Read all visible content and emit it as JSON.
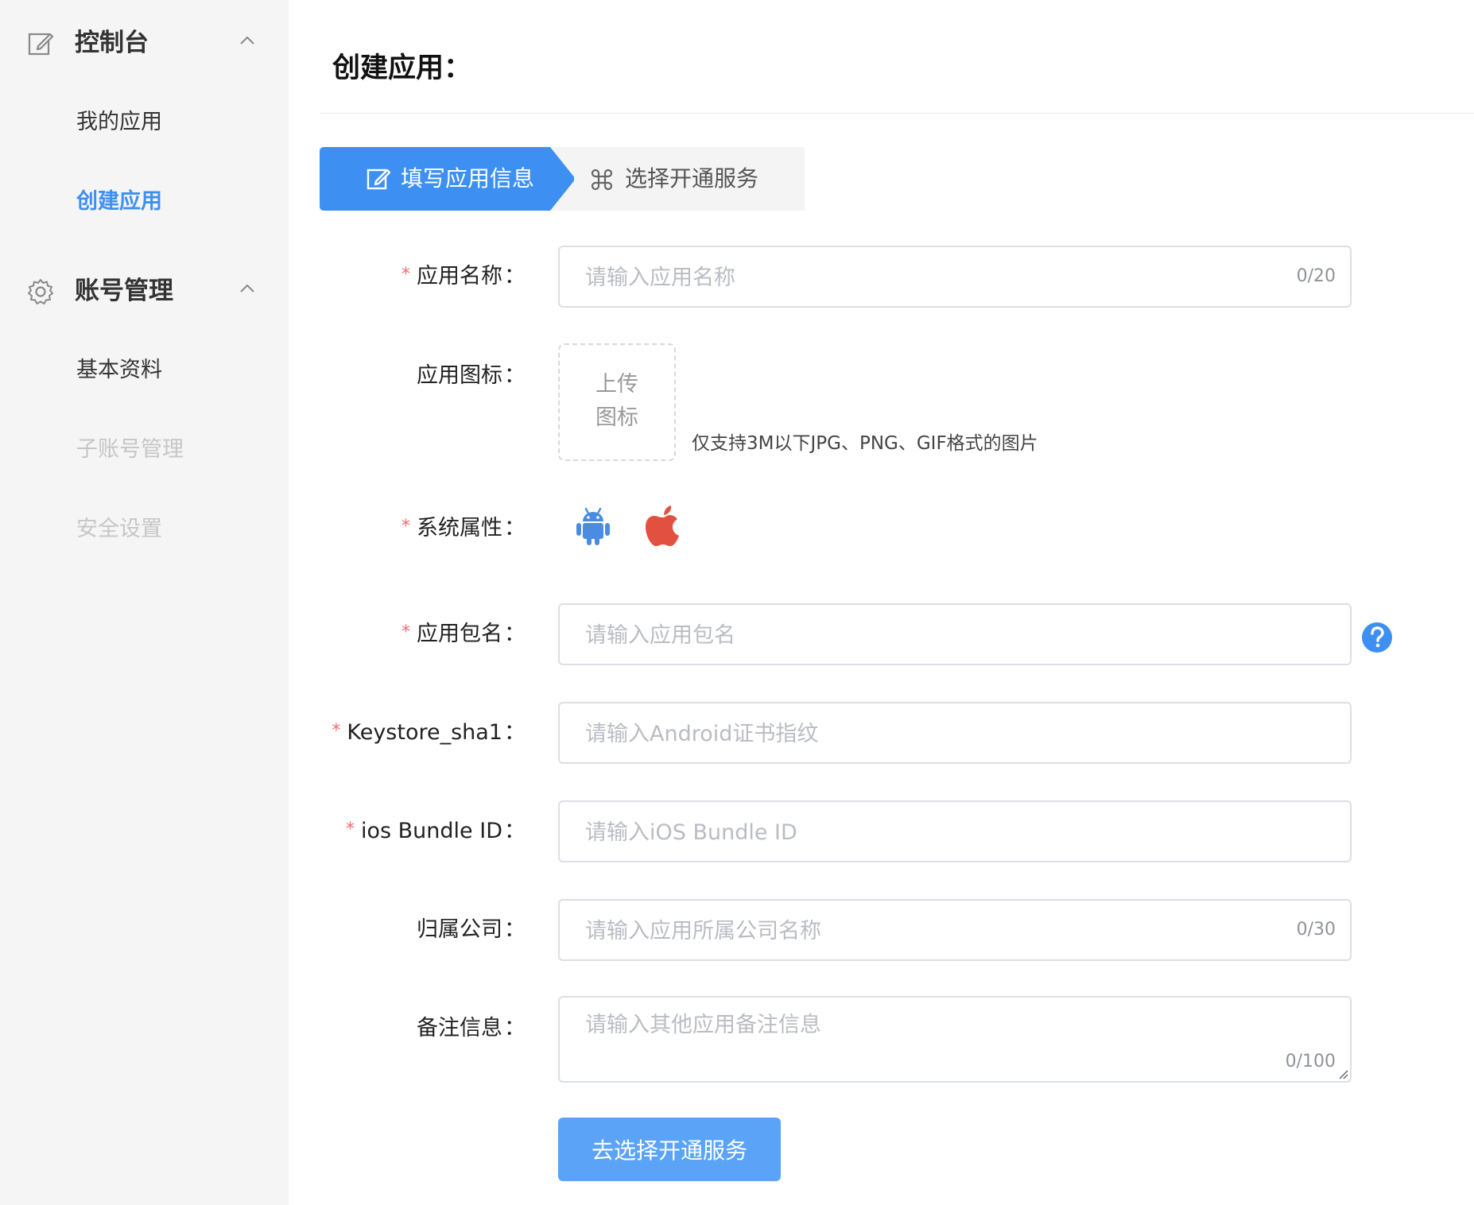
{
  "sidebar": {
    "groups": [
      {
        "title": "控制台",
        "icon": "edit-icon",
        "items": [
          {
            "label": "我的应用",
            "state": "normal"
          },
          {
            "label": "创建应用",
            "state": "active"
          }
        ]
      },
      {
        "title": "账号管理",
        "icon": "gear-icon",
        "items": [
          {
            "label": "基本资料",
            "state": "normal"
          },
          {
            "label": "子账号管理",
            "state": "disabled"
          },
          {
            "label": "安全设置",
            "state": "disabled"
          }
        ]
      }
    ]
  },
  "page": {
    "title": "创建应用："
  },
  "steps": [
    {
      "label": "填写应用信息",
      "icon": "edit-icon",
      "active": true
    },
    {
      "label": "选择开通服务",
      "icon": "command-icon",
      "active": false
    }
  ],
  "form": {
    "app_name": {
      "label": "应用名称",
      "required": true,
      "placeholder": "请输入应用名称",
      "counter": "0/20"
    },
    "app_icon": {
      "label": "应用图标",
      "required": false,
      "upload_text_line1": "上传",
      "upload_text_line2": "图标",
      "hint": "仅支持3M以下JPG、PNG、GIF格式的图片"
    },
    "system": {
      "label": "系统属性",
      "required": true,
      "options": [
        "android-icon",
        "apple-icon"
      ]
    },
    "package_name": {
      "label": "应用包名",
      "required": true,
      "placeholder": "请输入应用包名",
      "help_icon": "question-icon"
    },
    "keystore": {
      "label": "Keystore_sha1",
      "required": true,
      "placeholder": "请输入Android证书指纹"
    },
    "bundle_id": {
      "label": "ios Bundle ID",
      "required": true,
      "placeholder": "请输入iOS Bundle ID"
    },
    "company": {
      "label": "归属公司",
      "required": false,
      "placeholder": "请输入应用所属公司名称",
      "counter": "0/30"
    },
    "remark": {
      "label": "备注信息",
      "required": false,
      "placeholder": "请输入其他应用备注信息",
      "counter": "0/100"
    },
    "colon": "："
  },
  "submit_label": "去选择开通服务",
  "colors": {
    "primary": "#3d8ff2",
    "button": "#5ba3f7",
    "required": "#f56c6c",
    "android": "#4a8de0",
    "apple": "#e2513f"
  }
}
